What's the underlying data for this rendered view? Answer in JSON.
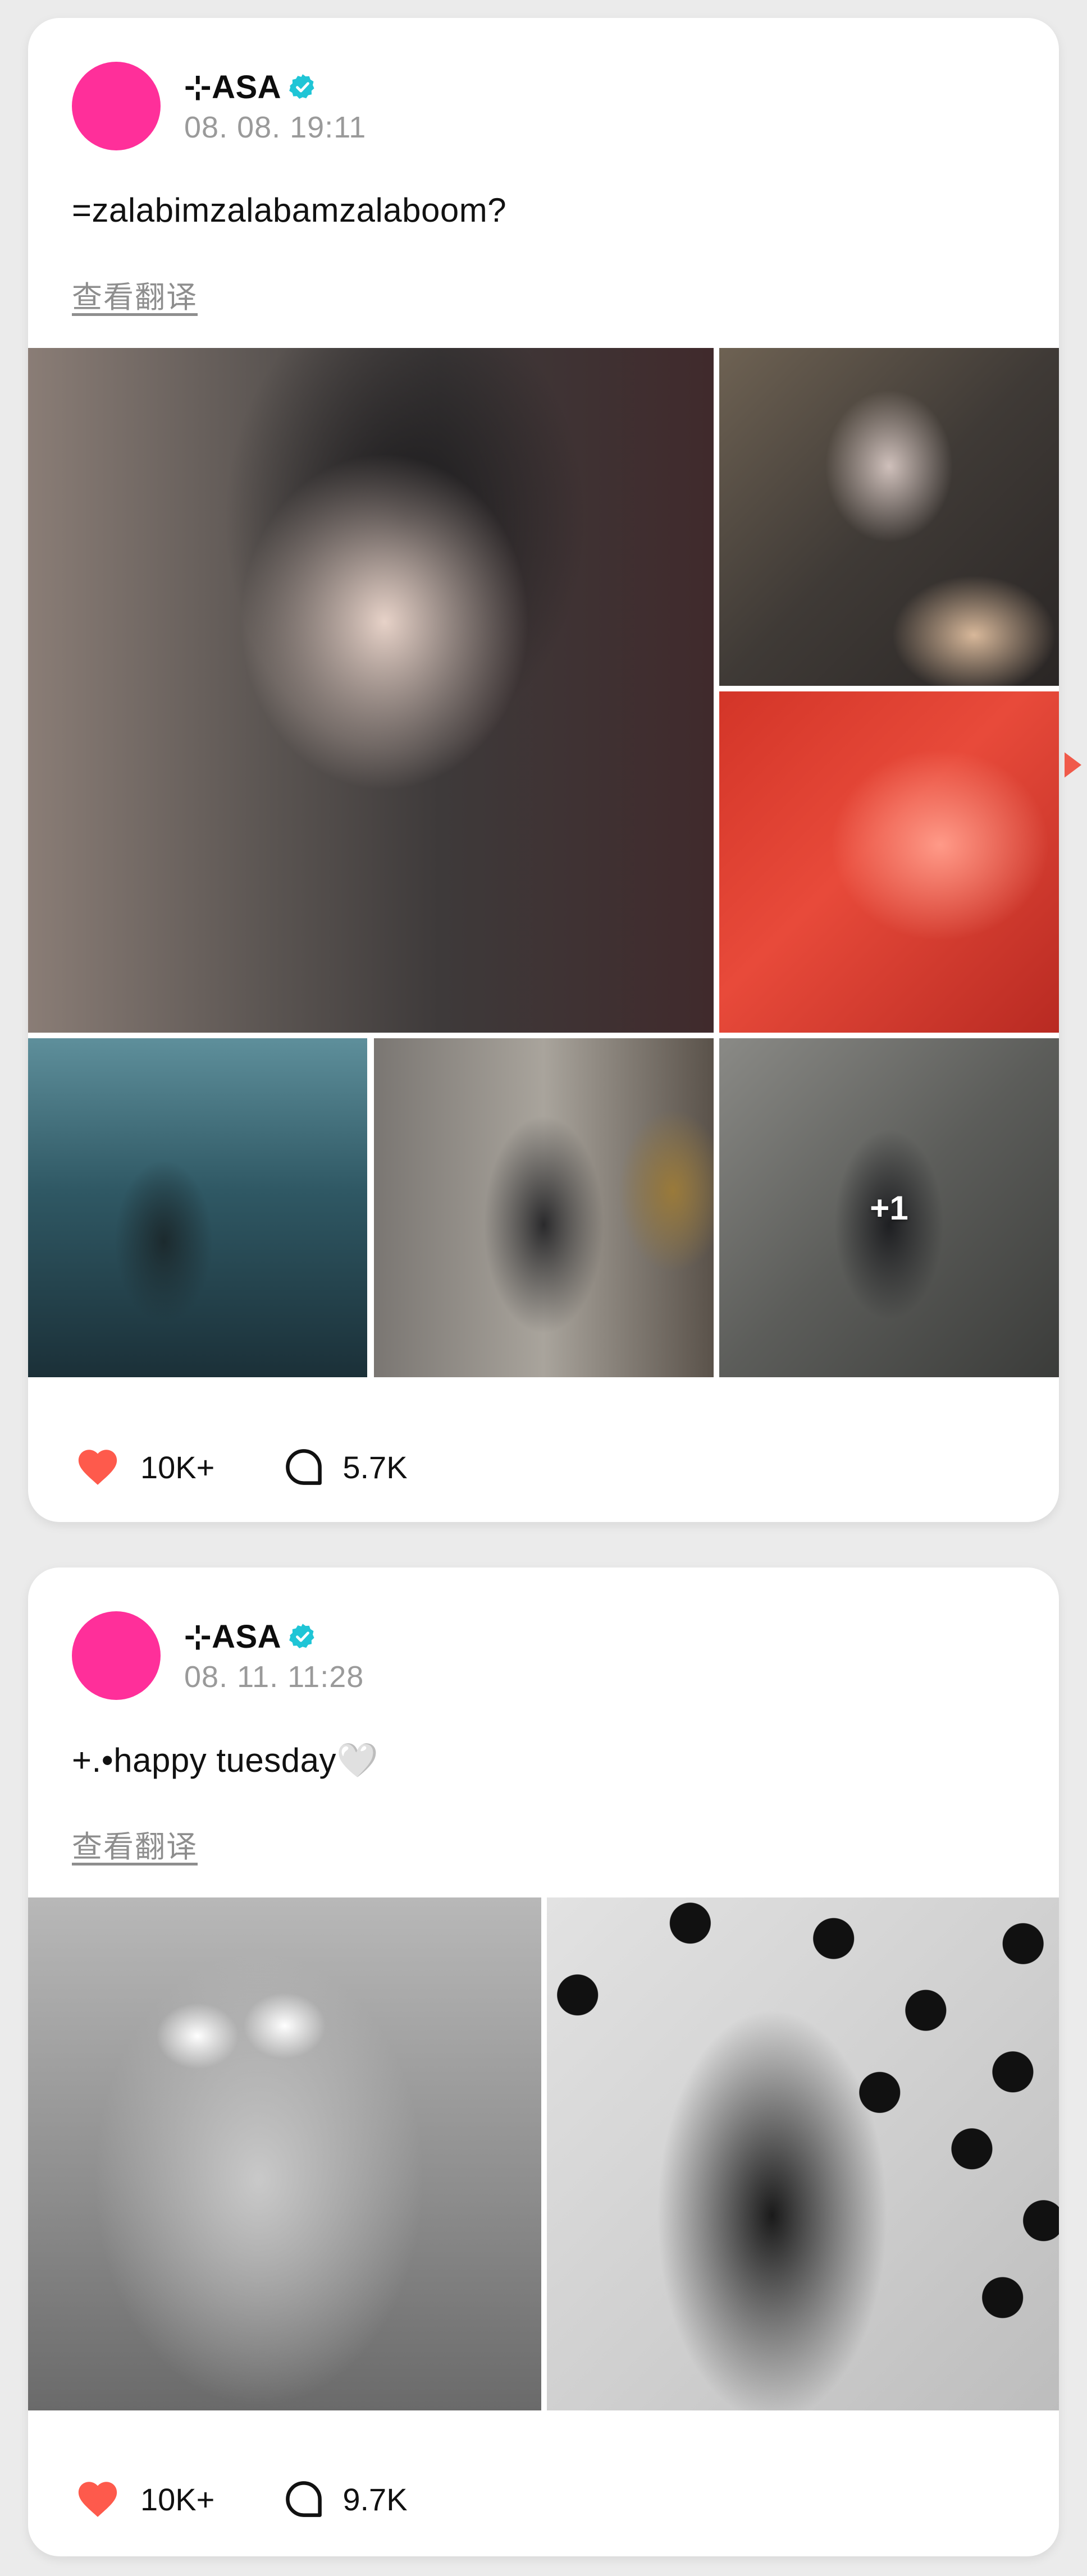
{
  "posts": [
    {
      "username": "⊹ASA",
      "timestamp": "08. 08. 19:11",
      "text": "=zalabimzalabamzalaboom?",
      "translate_label": "查看翻译",
      "more_count": "+1",
      "likes": "10K+",
      "comments": "5.7K"
    },
    {
      "username": "⊹ASA",
      "timestamp": "08. 11. 11:28",
      "text": "+.•happy tuesday🤍",
      "translate_label": "查看翻译",
      "likes": "10K+",
      "comments": "9.7K"
    }
  ],
  "colors": {
    "avatar": "#ff2f9a",
    "verified": "#1fc5d6",
    "like": "#fe5a4c",
    "background": "#ebebeb"
  },
  "icons": [
    "verified-badge-icon",
    "heart-icon",
    "comment-bubble-icon",
    "chevron-right-icon"
  ]
}
